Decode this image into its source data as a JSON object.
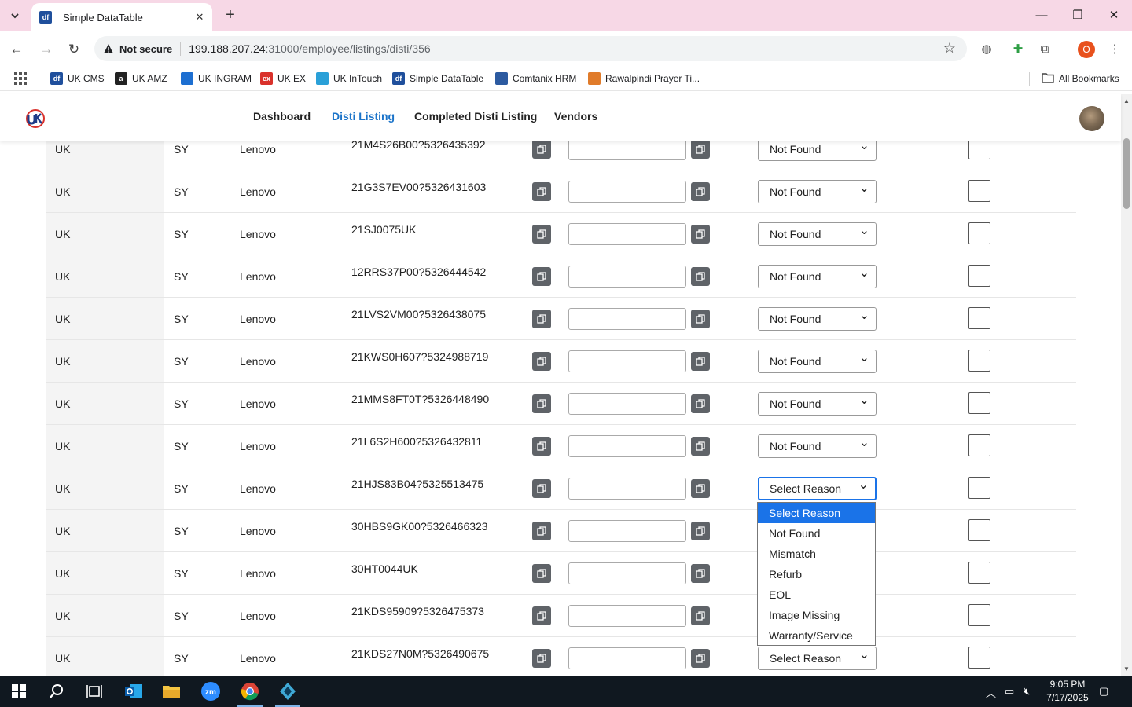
{
  "browser": {
    "tab_title": "Simple DataTable",
    "tab_favicon": "df",
    "security_label": "Not secure",
    "url_host": "199.188.207.24",
    "url_path": ":31000/employee/listings/disti/356",
    "profile_initial": "O",
    "bookmarks": [
      {
        "label": "UK CMS",
        "icon": "df",
        "color": "#1f4f9c"
      },
      {
        "label": "UK AMZ",
        "icon": "a",
        "color": "#222222"
      },
      {
        "label": "UK INGRAM",
        "icon": "ingram-icon",
        "color": "#1d6fd1"
      },
      {
        "label": "UK EX",
        "icon": "ex",
        "color": "#d9312b"
      },
      {
        "label": "UK InTouch",
        "icon": "intouch-icon",
        "color": "#2aa0d8"
      },
      {
        "label": "Simple DataTable",
        "icon": "df",
        "color": "#1f4f9c"
      },
      {
        "label": "Comtanix HRM",
        "icon": "comtanix-icon",
        "color": "#2c5aa0"
      },
      {
        "label": "Rawalpindi Prayer Ti...",
        "icon": "prayer-icon",
        "color": "#e07b2a"
      }
    ],
    "all_bookmarks_label": "All Bookmarks"
  },
  "header": {
    "nav": [
      {
        "label": "Dashboard",
        "active": false
      },
      {
        "label": "Disti Listing",
        "active": true
      },
      {
        "label": "Completed Disti Listing",
        "active": false
      },
      {
        "label": "Vendors",
        "active": false
      }
    ],
    "accent_color": "#1a73c9"
  },
  "rows": [
    {
      "region": "UK",
      "code": "SY",
      "brand": "Lenovo",
      "part": "21M4S26B00?5326435392",
      "reason": "Not Found"
    },
    {
      "region": "UK",
      "code": "SY",
      "brand": "Lenovo",
      "part": "21G3S7EV00?5326431603",
      "reason": "Not Found"
    },
    {
      "region": "UK",
      "code": "SY",
      "brand": "Lenovo",
      "part": "21SJ0075UK",
      "reason": "Not Found"
    },
    {
      "region": "UK",
      "code": "SY",
      "brand": "Lenovo",
      "part": "12RRS37P00?5326444542",
      "reason": "Not Found"
    },
    {
      "region": "UK",
      "code": "SY",
      "brand": "Lenovo",
      "part": "21LVS2VM00?5326438075",
      "reason": "Not Found"
    },
    {
      "region": "UK",
      "code": "SY",
      "brand": "Lenovo",
      "part": "21KWS0H607?5324988719",
      "reason": "Not Found"
    },
    {
      "region": "UK",
      "code": "SY",
      "brand": "Lenovo",
      "part": "21MMS8FT0T?5326448490",
      "reason": "Not Found"
    },
    {
      "region": "UK",
      "code": "SY",
      "brand": "Lenovo",
      "part": "21L6S2H600?5326432811",
      "reason": "Not Found"
    },
    {
      "region": "UK",
      "code": "SY",
      "brand": "Lenovo",
      "part": "21HJS83B04?5325513475",
      "reason": "Select Reason"
    },
    {
      "region": "UK",
      "code": "SY",
      "brand": "Lenovo",
      "part": "30HBS9GK00?5326466323",
      "reason": ""
    },
    {
      "region": "UK",
      "code": "SY",
      "brand": "Lenovo",
      "part": "30HT0044UK",
      "reason": ""
    },
    {
      "region": "UK",
      "code": "SY",
      "brand": "Lenovo",
      "part": "21KDS95909?5326475373",
      "reason": ""
    },
    {
      "region": "UK",
      "code": "SY",
      "brand": "Lenovo",
      "part": "21KDS27N0M?5326490675",
      "reason": "Select Reason"
    }
  ],
  "focused_row_index": 8,
  "dropdown": {
    "options": [
      "Select Reason",
      "Not Found",
      "Mismatch",
      "Refurb",
      "EOL",
      "Image Missing",
      "Warranty/Service"
    ],
    "highlighted_index": 0
  },
  "taskbar": {
    "time": "9:05 PM",
    "date": "7/17/2025",
    "apps": [
      "windows-start-icon",
      "search-icon",
      "task-view-icon",
      "outlook-icon",
      "file-explorer-icon",
      "zoom-icon",
      "chrome-icon",
      "app-icon"
    ]
  }
}
